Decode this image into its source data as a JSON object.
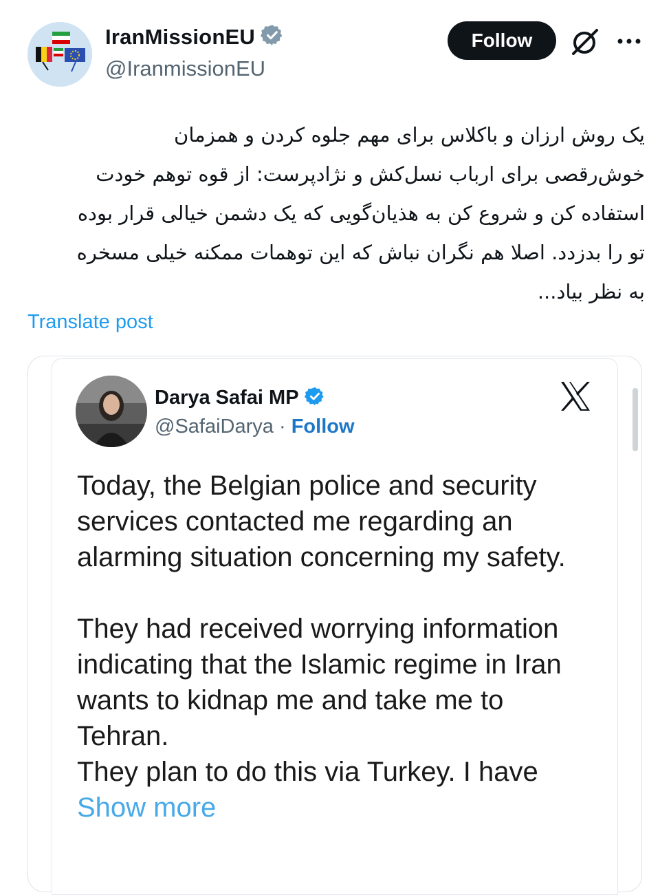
{
  "author": {
    "display_name": "IranMissionEU",
    "handle": "@IranmissionEU"
  },
  "actions": {
    "follow_label": "Follow"
  },
  "post": {
    "text": "یک روش ارزان و باکلاس برای مهم جلوه کردن و همزمان خوش‌رقصی برای ارباب نسل‌کش و نژادپرست: از قوه توهم خودت استفاده کن و شروع کن به هذیان‌گویی که یک دشمن خیالی قرار بوده تو را بدزدد. اصلا هم نگران نباش که این توهمات ممکنه خیلی مسخره به نظر بیاد...",
    "translate_label": "Translate post"
  },
  "quoted": {
    "display_name": "Darya Safai MP",
    "handle": "@SafaiDarya",
    "separator": "·",
    "follow_label": "Follow",
    "text": "Today, the Belgian police and security services contacted me regarding an alarming situation concerning my safety.\n\nThey had received worrying information indicating that the Islamic regime in Iran wants to kidnap me and take me to Tehran.\nThey plan to do this via Turkey. I have ",
    "show_more_label": "Show more"
  },
  "colors": {
    "accent": "#1d9bf0",
    "follow_button": "#0f1419",
    "verified_badge": "#829aab",
    "quoted_verified_badge": "#1d9bf0",
    "secondary_text": "#536471"
  },
  "icons": {
    "verified": "verified-badge-icon",
    "grok": "grok-icon",
    "more": "more-options-icon",
    "x_logo": "x-logo-icon"
  }
}
